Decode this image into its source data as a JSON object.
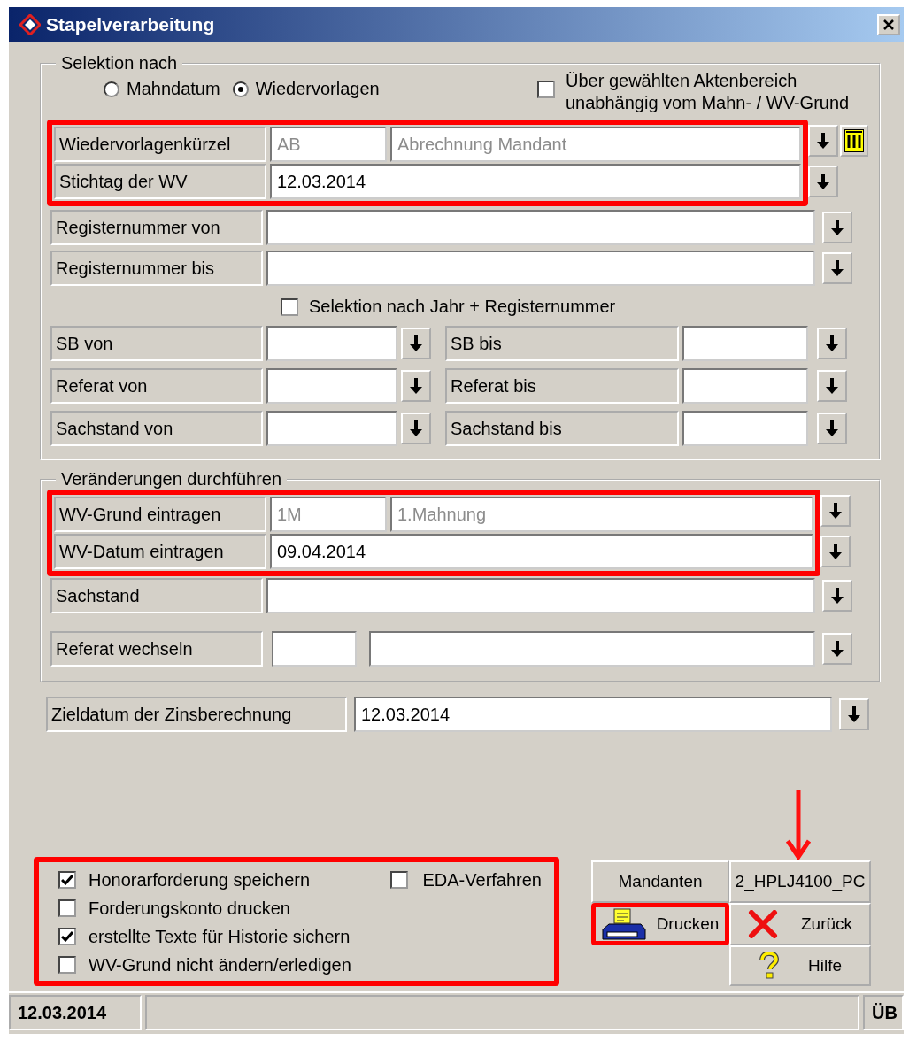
{
  "window": {
    "title": "Stapelverarbeitung"
  },
  "selection": {
    "legend": "Selektion nach",
    "radios": [
      {
        "label": "Mahndatum",
        "selected": false
      },
      {
        "label": "Wiedervorlagen",
        "selected": true
      }
    ],
    "scope_checkbox": {
      "label": "Über gewählten Aktenbereich unabhängig vom Mahn- / WV-Grund",
      "checked": false
    },
    "highlighted_rows": [
      {
        "label": "Wiedervorlagenkürzel",
        "kind": "lookup",
        "code": "AB",
        "description": "Abrechnung Mandant"
      },
      {
        "label": "Stichtag der WV",
        "kind": "single",
        "value": "12.03.2014"
      }
    ],
    "rows": [
      {
        "label": "Registernummer von",
        "kind": "single"
      },
      {
        "label": "Registernummer bis",
        "kind": "single"
      }
    ],
    "year_checkbox": {
      "label": "Selektion nach Jahr + Registernummer",
      "checked": false
    },
    "ranges": [
      {
        "from_label": "SB von",
        "to_label": "SB bis"
      },
      {
        "from_label": "Referat von",
        "to_label": "Referat bis"
      },
      {
        "from_label": "Sachstand von",
        "to_label": "Sachstand bis"
      }
    ]
  },
  "changes": {
    "legend": "Veränderungen durchführen",
    "highlighted_rows": [
      {
        "label": "WV-Grund eintragen",
        "kind": "code",
        "code": "1M",
        "description": "1.Mahnung"
      },
      {
        "label": "WV-Datum eintragen",
        "kind": "single",
        "value": "09.04.2014"
      }
    ],
    "rows": [
      {
        "label": "Sachstand",
        "kind": "single"
      },
      {
        "label": "Referat wechseln",
        "kind": "split"
      }
    ]
  },
  "target_date": {
    "label": "Zieldatum der Zinsberechnung",
    "value": "12.03.2014"
  },
  "options": [
    {
      "label": "Honorarforderung speichern",
      "checked": true
    },
    {
      "label": "Forderungskonto drucken",
      "checked": false
    },
    {
      "label": "erstellte Texte für Historie sichern",
      "checked": true
    },
    {
      "label": "WV-Grund nicht ändern/erledigen",
      "checked": false
    }
  ],
  "side_option": {
    "label": "EDA-Verfahren",
    "checked": false
  },
  "buttons": [
    {
      "label": "Mandanten",
      "kind": "plain"
    },
    {
      "label": "2_HPLJ4100_PC",
      "kind": "plain"
    },
    {
      "label": "Drucken",
      "kind": "print"
    },
    {
      "label": "Zurück",
      "kind": "back"
    },
    {
      "label": "Hilfe",
      "kind": "help"
    }
  ],
  "status_bar": {
    "date": "12.03.2014",
    "mode": "ÜB"
  }
}
